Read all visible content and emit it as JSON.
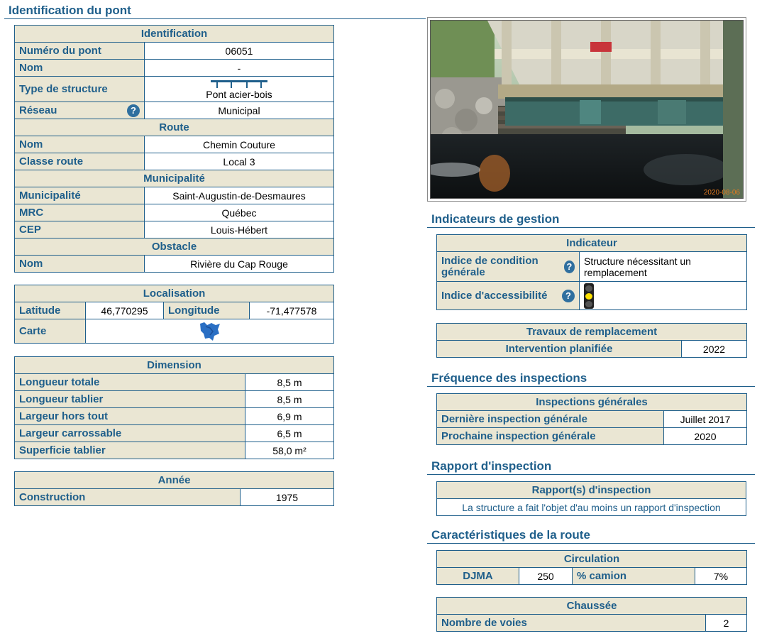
{
  "left": {
    "section_title": "Identification du pont",
    "identification": {
      "header": "Identification",
      "numero_label": "Numéro du pont",
      "numero_value": "06051",
      "nom_label": "Nom",
      "nom_value": "-",
      "type_label": "Type de structure",
      "type_value": "Pont acier-bois",
      "reseau_label": "Réseau",
      "reseau_value": "Municipal"
    },
    "route": {
      "header": "Route",
      "nom_label": "Nom",
      "nom_value": "Chemin Couture",
      "classe_label": "Classe route",
      "classe_value": "Local 3"
    },
    "municipalite": {
      "header": "Municipalité",
      "muni_label": "Municipalité",
      "muni_value": "Saint-Augustin-de-Desmaures",
      "mrc_label": "MRC",
      "mrc_value": "Québec",
      "cep_label": "CEP",
      "cep_value": "Louis-Hébert"
    },
    "obstacle": {
      "header": "Obstacle",
      "nom_label": "Nom",
      "nom_value": "Rivière du Cap Rouge"
    },
    "localisation": {
      "header": "Localisation",
      "lat_label": "Latitude",
      "lat_value": "46,770295",
      "lon_label": "Longitude",
      "lon_value": "-71,477578",
      "carte_label": "Carte"
    },
    "dimension": {
      "header": "Dimension",
      "rows": [
        {
          "label": "Longueur totale",
          "value": "8,5 m"
        },
        {
          "label": "Longueur tablier",
          "value": "8,5 m"
        },
        {
          "label": "Largeur hors tout",
          "value": "6,9 m"
        },
        {
          "label": "Largeur carrossable",
          "value": "6,5 m"
        },
        {
          "label": "Superficie tablier",
          "value": "58,0 m²"
        }
      ]
    },
    "annee": {
      "header": "Année",
      "construction_label": "Construction",
      "construction_value": "1975"
    }
  },
  "right": {
    "photo_date": "2020-08-06",
    "gestion": {
      "section_title": "Indicateurs de gestion",
      "header": "Indicateur",
      "icg_label": "Indice de condition générale",
      "icg_value": "Structure nécessitant un remplacement",
      "acc_label": "Indice d'accessibilité"
    },
    "travaux": {
      "header": "Travaux de remplacement",
      "label": "Intervention planifiée",
      "value": "2022"
    },
    "frequence": {
      "section_title": "Fréquence des inspections",
      "header": "Inspections générales",
      "derniere_label": "Dernière inspection générale",
      "derniere_value": "Juillet 2017",
      "prochaine_label": "Prochaine inspection générale",
      "prochaine_value": "2020"
    },
    "rapport": {
      "section_title": "Rapport d'inspection",
      "header": "Rapport(s) d'inspection",
      "text": "La structure a fait l'objet d'au moins un rapport d'inspection"
    },
    "caracteristiques": {
      "section_title": "Caractéristiques de la route",
      "circulation_header": "Circulation",
      "djma_label": "DJMA",
      "djma_value": "250",
      "camion_label": "% camion",
      "camion_value": "7%",
      "chaussee_header": "Chaussée",
      "voies_label": "Nombre de voies",
      "voies_value": "2"
    }
  },
  "colors": {
    "accent": "#1f5f8b",
    "header_bg": "#eae6d3",
    "light_on": "#ffe100"
  },
  "icons": [
    "help-icon",
    "bridge-type-icon",
    "map-icon",
    "traffic-light-icon"
  ]
}
